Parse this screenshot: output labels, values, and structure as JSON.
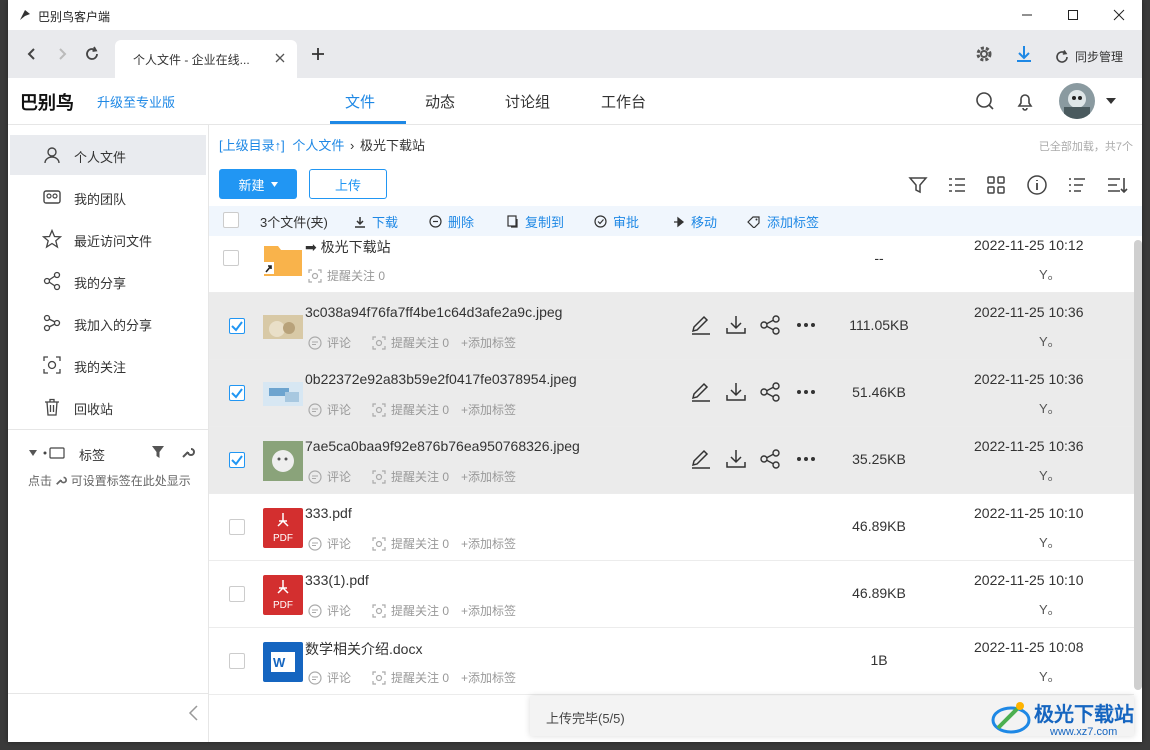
{
  "window": {
    "title": "巴别鸟客户端"
  },
  "browser": {
    "tab_title": "个人文件 - 企业在线..."
  },
  "toolbar": {
    "sync_label": "同步管理"
  },
  "app": {
    "logo": "巴别鸟",
    "upgrade": "升级至专业版",
    "tabs": [
      "文件",
      "动态",
      "讨论组",
      "工作台"
    ],
    "active_tab": "文件"
  },
  "sidebar": {
    "items": [
      {
        "label": "个人文件",
        "icon": "person-icon"
      },
      {
        "label": "我的团队",
        "icon": "team-icon"
      },
      {
        "label": "最近访问文件",
        "icon": "star-icon"
      },
      {
        "label": "我的分享",
        "icon": "share-icon"
      },
      {
        "label": "我加入的分享",
        "icon": "joined-share-icon"
      },
      {
        "label": "我的关注",
        "icon": "focus-icon"
      },
      {
        "label": "回收站",
        "icon": "trash-icon"
      }
    ],
    "tags_title": "标签",
    "tags_hint_pre": "点击",
    "tags_hint_post": "可设置标签在此处显示"
  },
  "breadcrumb": {
    "up": "[上级目录↑]",
    "root": "个人文件",
    "sep": "›",
    "current": "极光下载站"
  },
  "loaded_text": "已全部加载，共7个",
  "buttons": {
    "new": "新建",
    "upload": "上传"
  },
  "actions": {
    "selected": "3个文件(夹)",
    "download": "下载",
    "delete": "删除",
    "copy_to": "复制到",
    "approve": "审批",
    "move": "移动",
    "add_tag": "添加标签"
  },
  "meta_labels": {
    "comment": "评论",
    "remind": "提醒关注 0",
    "add_tag": "+添加标签"
  },
  "files": [
    {
      "name": "➡ 极光下载站",
      "type": "folder",
      "size": "--",
      "date": "2022-11-25 10:12",
      "owner": "Y。",
      "checked": false
    },
    {
      "name": "3c038a94f76fa7ff4be1c64d3afe2a9c.jpeg",
      "type": "image",
      "size": "111.05KB",
      "date": "2022-11-25 10:36",
      "owner": "Y。",
      "checked": true
    },
    {
      "name": "0b22372e92a83b59e2f0417fe0378954.jpeg",
      "type": "image",
      "size": "51.46KB",
      "date": "2022-11-25 10:36",
      "owner": "Y。",
      "checked": true
    },
    {
      "name": "7ae5ca0baa9f92e876b76ea950768326.jpeg",
      "type": "image",
      "size": "35.25KB",
      "date": "2022-11-25 10:36",
      "owner": "Y。",
      "checked": true
    },
    {
      "name": "333.pdf",
      "type": "pdf",
      "size": "46.89KB",
      "date": "2022-11-25 10:10",
      "owner": "Y。",
      "checked": false
    },
    {
      "name": "333(1).pdf",
      "type": "pdf",
      "size": "46.89KB",
      "date": "2022-11-25 10:10",
      "owner": "Y。",
      "checked": false
    },
    {
      "name": "数学相关介绍.docx",
      "type": "docx",
      "size": "1B",
      "date": "2022-11-25 10:08",
      "owner": "Y。",
      "checked": false
    }
  ],
  "file_badges": {
    "pdf": "PDF",
    "docx": "W"
  },
  "toast": "上传完毕(5/5)",
  "watermark": {
    "name": "极光下载站",
    "url": "www.xz7.com"
  },
  "colors": {
    "accent": "#1e88e5",
    "pdf": "#d32f2f",
    "word": "#1565c0",
    "folder": "#f9b34b"
  }
}
